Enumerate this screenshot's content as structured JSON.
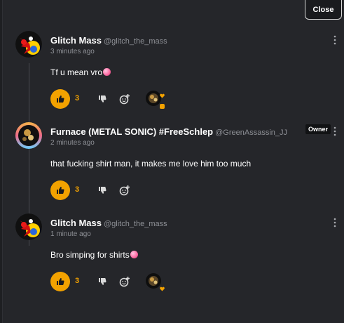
{
  "header": {
    "close_label": "Close"
  },
  "comments": [
    {
      "name": "Glitch Mass",
      "handle": "@glitch_the_mass",
      "time": "3 minutes ago",
      "text": "Tf u mean vro",
      "emoji": "laughing-emoji",
      "likes": "3",
      "reaction_heart": "orange-heart-icon"
    },
    {
      "name": "Furnace (METAL SONIC) #FreeSchlep",
      "handle": "@GreenAssassin_JJ",
      "badge": "Owner",
      "time": "2 minutes ago",
      "text": "that fucking shirt man, it makes me love him too much",
      "likes": "3"
    },
    {
      "name": "Glitch Mass",
      "handle": "@glitch_the_mass",
      "time": "1 minute ago",
      "text": "Bro simping for shirts",
      "emoji": "laughing-emoji",
      "likes": "3",
      "reaction_heart": "orange-heart-icon"
    }
  ],
  "colors": {
    "background": "#25262a",
    "accent": "#f3a200",
    "text": "#ffffff",
    "muted": "#8e9096"
  }
}
